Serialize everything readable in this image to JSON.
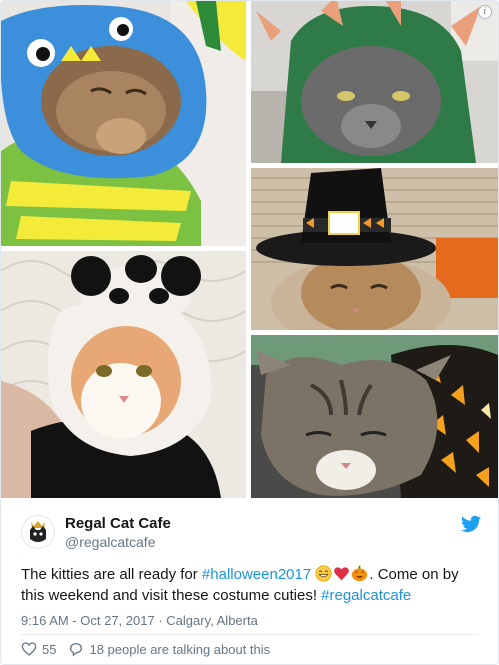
{
  "tweet": {
    "display_name": "Regal Cat Cafe",
    "handle": "@regalcatcafe",
    "text_before": "The kitties are all ready for ",
    "hashtag1": "#halloween2017",
    "text_middle": ". Come on by this weekend and visit these costume cuties! ",
    "hashtag2": "#regalcatcafe",
    "timestamp": "9:16 AM - Oct 27, 2017",
    "separator": "·",
    "location": "Calgary, Alberta",
    "likes": "55",
    "talking": "18 people are talking about this",
    "info_icon": "i"
  },
  "colors": {
    "link": "#1b95e0",
    "text": "#14171a",
    "muted": "#657786",
    "heart": "#e0245e"
  },
  "icons": [
    "info-icon",
    "twitter-bird-icon",
    "heart-icon",
    "reply-bubble-icon",
    "grin-emoji-icon",
    "red-heart-emoji-icon",
    "jack-o-lantern-emoji-icon",
    "cat-crown-logo"
  ]
}
